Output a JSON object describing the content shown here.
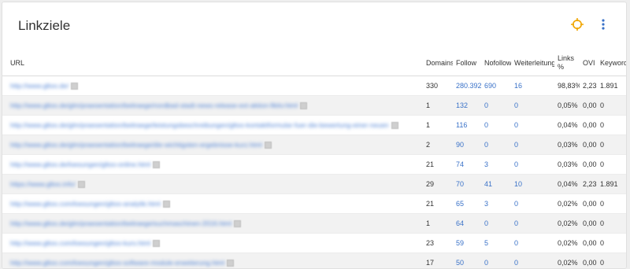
{
  "header": {
    "title": "Linkziele",
    "accent_color": "#f0a500",
    "menu_color": "#3a72c8"
  },
  "table": {
    "columns": {
      "url": "URL",
      "domains": "Domains",
      "follow": "Follow",
      "nofollow": "Nofollow",
      "weiterleitung": "Weiterleitung",
      "links_pct_a": "Links",
      "links_pct_b": "%",
      "ovi": "OVI",
      "keyword": "Keyword"
    },
    "rows": [
      {
        "url": "http://www.gltoo.de/",
        "domains": "330",
        "follow": "280.392",
        "nofollow": "690",
        "weiterleitung": "16",
        "links_pct": "98,83%",
        "ovi": "2,23",
        "keyword": "1.891"
      },
      {
        "url": "http://www.gltoo.de/glm/praesentation/beitraege/nordbad-stadt-news-release-ext-aktion-fiktiv.html",
        "domains": "1",
        "follow": "132",
        "nofollow": "0",
        "weiterleitung": "0",
        "links_pct": "0,05%",
        "ovi": "0,00",
        "keyword": "0"
      },
      {
        "url": "http://www.gltoo.de/glm/praesentation/beitraege/leistungsbeschreibungen/gltoo-kontaktformular-fuer-die-bewertung-einer-neuen",
        "domains": "1",
        "follow": "116",
        "nofollow": "0",
        "weiterleitung": "0",
        "links_pct": "0,04%",
        "ovi": "0,00",
        "keyword": "0"
      },
      {
        "url": "http://www.gltoo.de/glm/praesentation/beitraege/die-wichtigsten-ergebnisse-kurz.html",
        "domains": "2",
        "follow": "90",
        "nofollow": "0",
        "weiterleitung": "0",
        "links_pct": "0,03%",
        "ovi": "0,00",
        "keyword": "0"
      },
      {
        "url": "http://www.gltoo.de/loesungen/gltoo-online.html",
        "domains": "21",
        "follow": "74",
        "nofollow": "3",
        "weiterleitung": "0",
        "links_pct": "0,03%",
        "ovi": "0,00",
        "keyword": "0"
      },
      {
        "url": "https://www.gltoo.info/",
        "domains": "29",
        "follow": "70",
        "nofollow": "41",
        "weiterleitung": "10",
        "links_pct": "0,04%",
        "ovi": "2,23",
        "keyword": "1.891"
      },
      {
        "url": "http://www.gltoo.com/loesungen/gltoo-analytik.html",
        "domains": "21",
        "follow": "65",
        "nofollow": "3",
        "weiterleitung": "0",
        "links_pct": "0,02%",
        "ovi": "0,00",
        "keyword": "0"
      },
      {
        "url": "http://www.gltoo.de/glm/praesentation/beitraege/suchmaschinen-2016.html",
        "domains": "1",
        "follow": "64",
        "nofollow": "0",
        "weiterleitung": "0",
        "links_pct": "0,02%",
        "ovi": "0,00",
        "keyword": "0"
      },
      {
        "url": "http://www.gltoo.com/loesungen/gltoo-kurs.html",
        "domains": "23",
        "follow": "59",
        "nofollow": "5",
        "weiterleitung": "0",
        "links_pct": "0,02%",
        "ovi": "0,00",
        "keyword": "0"
      },
      {
        "url": "http://www.gltoo.com/loesungen/gltoo-software-module-erweiterung.html",
        "domains": "17",
        "follow": "50",
        "nofollow": "0",
        "weiterleitung": "0",
        "links_pct": "0,02%",
        "ovi": "0,00",
        "keyword": "0"
      }
    ]
  }
}
